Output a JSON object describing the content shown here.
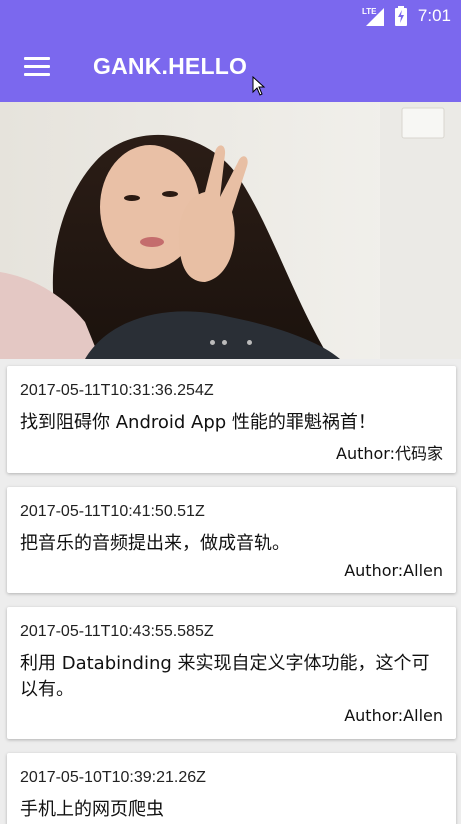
{
  "status_bar": {
    "network": "LTE",
    "time": "7:01"
  },
  "toolbar": {
    "title": "GANK.HELLO"
  },
  "banner": {
    "image": "selfie photo of a woman making a peace sign",
    "page_indicator_count": 3
  },
  "articles": [
    {
      "date": "2017-05-11T10:31:36.254Z",
      "title": "找到阻碍你 Android App 性能的罪魁祸首！",
      "author": "Author:代码家"
    },
    {
      "date": "2017-05-11T10:41:50.51Z",
      "title": "把音乐的音频提出来，做成音轨。",
      "author": "Author:Allen"
    },
    {
      "date": "2017-05-11T10:43:55.585Z",
      "title": "利用 Databinding 来实现自定义字体功能，这个可以有。",
      "author": "Author:Allen"
    },
    {
      "date": "2017-05-10T10:39:21.26Z",
      "title": "手机上的网页爬虫",
      "author": ""
    }
  ],
  "colors": {
    "primary": "#7b68ee",
    "background": "#ededed",
    "card": "#ffffff"
  }
}
